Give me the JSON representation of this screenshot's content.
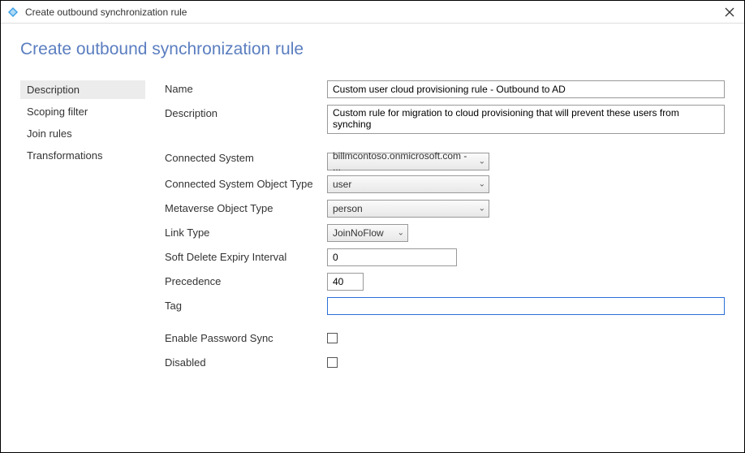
{
  "window": {
    "title": "Create outbound synchronization rule"
  },
  "page": {
    "title": "Create outbound synchronization rule"
  },
  "sidebar": {
    "items": [
      {
        "label": "Description",
        "active": true
      },
      {
        "label": "Scoping filter",
        "active": false
      },
      {
        "label": "Join rules",
        "active": false
      },
      {
        "label": "Transformations",
        "active": false
      }
    ]
  },
  "form": {
    "name": {
      "label": "Name",
      "value": "Custom user cloud provisioning rule - Outbound to AD"
    },
    "description": {
      "label": "Description",
      "value": "Custom rule for migration to cloud provisioning that will prevent these users from synching"
    },
    "connected_system": {
      "label": "Connected System",
      "value": "billmcontoso.onmicrosoft.com - ..."
    },
    "cs_object_type": {
      "label": "Connected System Object Type",
      "value": "user"
    },
    "mv_object_type": {
      "label": "Metaverse Object Type",
      "value": "person"
    },
    "link_type": {
      "label": "Link Type",
      "value": "JoinNoFlow"
    },
    "soft_delete": {
      "label": "Soft Delete Expiry Interval",
      "value": "0"
    },
    "precedence": {
      "label": "Precedence",
      "value": "40"
    },
    "tag": {
      "label": "Tag",
      "value": ""
    },
    "enable_pw_sync": {
      "label": "Enable Password Sync",
      "checked": false
    },
    "disabled": {
      "label": "Disabled",
      "checked": false
    }
  }
}
